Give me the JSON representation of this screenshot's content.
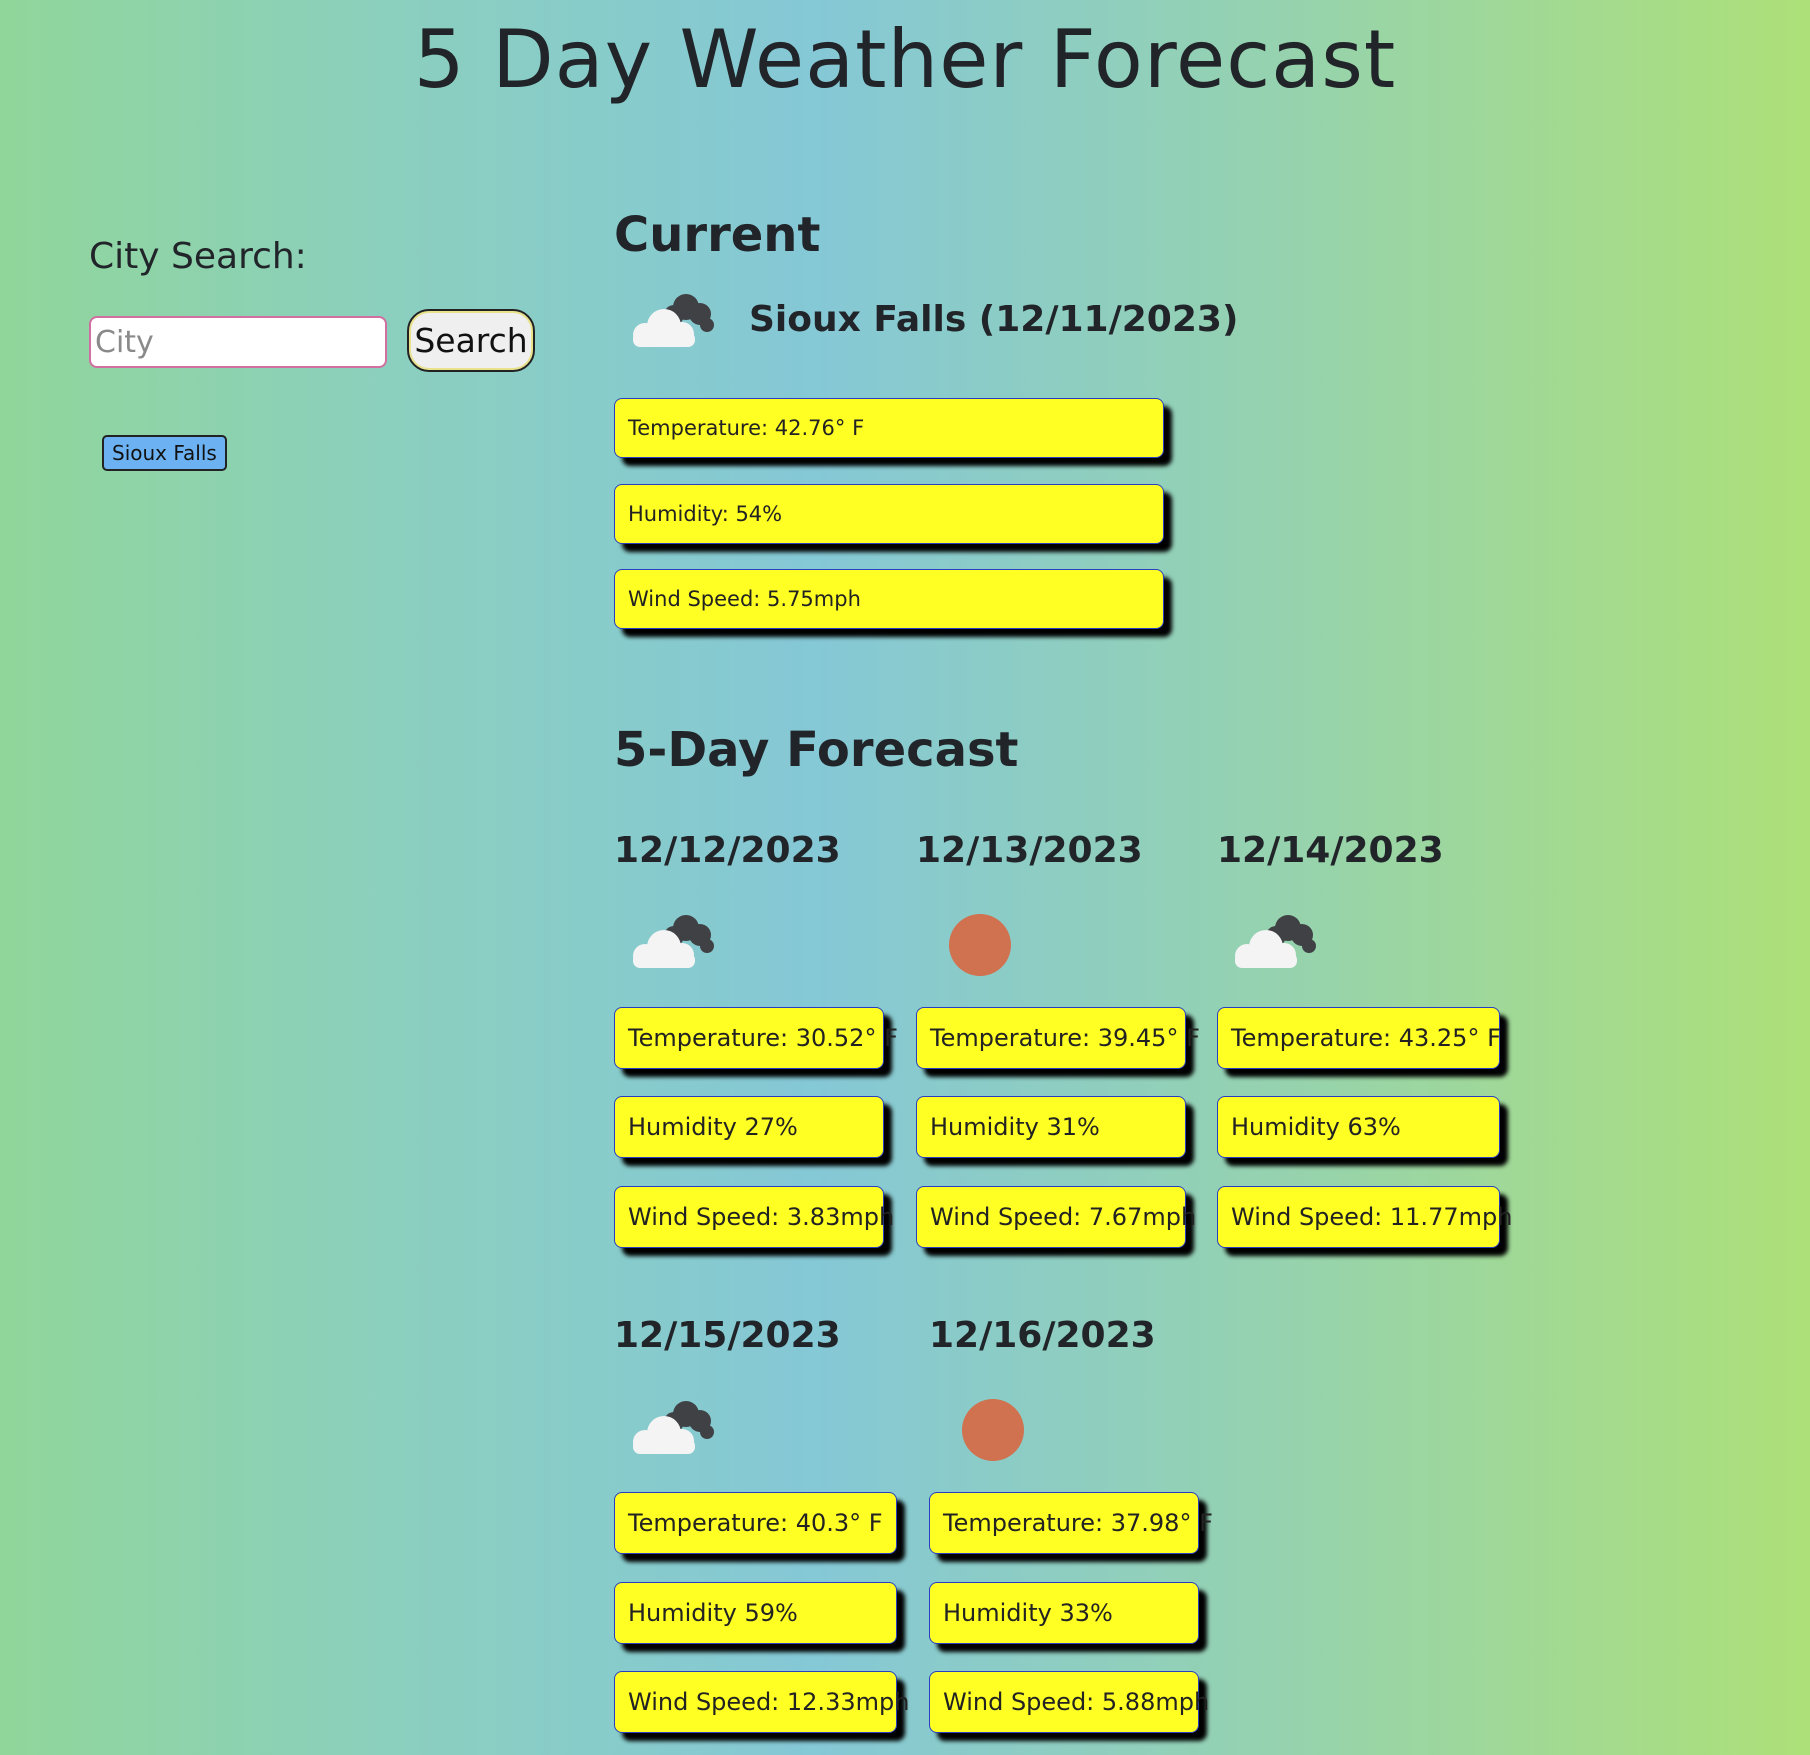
{
  "page_title": "5 Day Weather Forecast",
  "search": {
    "label": "City Search:",
    "placeholder": "City",
    "value": "",
    "button_label": "Search"
  },
  "history": [
    "Sioux Falls"
  ],
  "current": {
    "heading": "Current",
    "city_date": "Sioux Falls (12/11/2023)",
    "icon": "cloudy-icon",
    "temperature": "Temperature: 42.76° F",
    "humidity": "Humidity: 54%",
    "wind": "Wind Speed: 5.75mph"
  },
  "forecast": {
    "heading": "5-Day Forecast",
    "days": [
      {
        "date": "12/12/2023",
        "icon": "cloudy-icon",
        "temperature": "Temperature: 30.52° F",
        "humidity": "Humidity 27%",
        "wind": "Wind Speed: 3.83mph"
      },
      {
        "date": "12/13/2023",
        "icon": "sun-icon",
        "temperature": "Temperature: 39.45° F",
        "humidity": "Humidity 31%",
        "wind": "Wind Speed: 7.67mph"
      },
      {
        "date": "12/14/2023",
        "icon": "cloudy-icon",
        "temperature": "Temperature: 43.25° F",
        "humidity": "Humidity 63%",
        "wind": "Wind Speed: 11.77mph"
      },
      {
        "date": "12/15/2023",
        "icon": "cloudy-icon",
        "temperature": "Temperature: 40.3° F",
        "humidity": "Humidity 59%",
        "wind": "Wind Speed: 12.33mph"
      },
      {
        "date": "12/16/2023",
        "icon": "sun-icon",
        "temperature": "Temperature: 37.98° F",
        "humidity": "Humidity 33%",
        "wind": "Wind Speed: 5.88mph"
      }
    ]
  },
  "colors": {
    "stat_box_bg": "#ffff24",
    "history_button_bg": "#6cb2f2",
    "sun": "#d0714f"
  }
}
